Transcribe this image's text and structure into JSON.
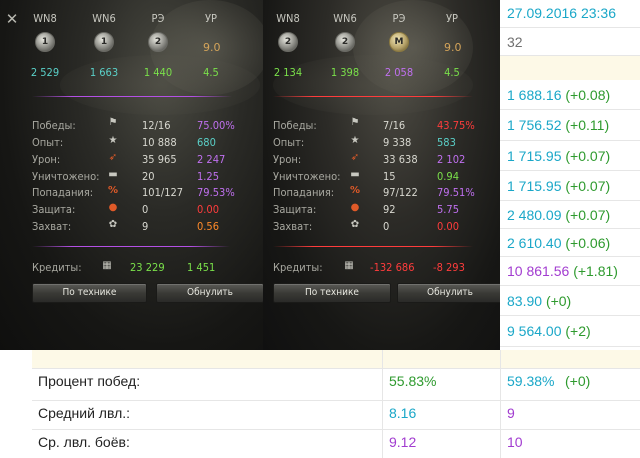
{
  "date_time": "27.09.2016 23:36",
  "battle_count": "32",
  "colors": {
    "green": "#2e9a2e",
    "teal": "#1aa7c8",
    "violet": "#a23cd0",
    "gray": "#707070",
    "game_cyan": "#5ad0c8",
    "game_green": "#7ae04a",
    "game_violet": "#c070f0",
    "game_red": "#ff3c3c",
    "game_yellow": "#e8d45a"
  },
  "game": {
    "close_icon": "close-icon",
    "buttons": {
      "by_vehicle": "По технике",
      "reset": "Обнулить"
    },
    "panels": [
      {
        "headers": [
          "WN8",
          "WN6",
          "РЭ",
          "УР"
        ],
        "medals": [
          "1",
          "1",
          "2"
        ],
        "level": "9.0",
        "ratings": [
          "2 529",
          "1 663",
          "1 440",
          "4.5"
        ],
        "rows": [
          {
            "label": "Победы:",
            "icon": "flag-icon",
            "value": "12/16",
            "extra": "75.00%"
          },
          {
            "label": "Опыт:",
            "icon": "star-icon",
            "value": "10 888",
            "extra": "680"
          },
          {
            "label": "Урон:",
            "icon": "shell-icon",
            "value": "35 965",
            "extra": "2 247"
          },
          {
            "label": "Уничтожено:",
            "icon": "tank-icon",
            "value": "20",
            "extra": "1.25"
          },
          {
            "label": "Попадания:",
            "icon": "percent-icon",
            "value": "101/127",
            "extra": "79.53%"
          },
          {
            "label": "Защита:",
            "icon": "defense-icon",
            "value": "0",
            "extra": "0.00"
          },
          {
            "label": "Захват:",
            "icon": "capture-icon",
            "value": "9",
            "extra": "0.56"
          }
        ],
        "credits_label": "Кредиты:",
        "credits": "23 229",
        "credits_avg": "1 451"
      },
      {
        "headers": [
          "WN8",
          "WN6",
          "РЭ",
          "УР"
        ],
        "medals": [
          "2",
          "2",
          "M"
        ],
        "level": "9.0",
        "ratings": [
          "2 134",
          "1 398",
          "2 058",
          "4.5"
        ],
        "rows": [
          {
            "label": "Победы:",
            "icon": "flag-icon",
            "value": "7/16",
            "extra": "43.75%"
          },
          {
            "label": "Опыт:",
            "icon": "star-icon",
            "value": "9 338",
            "extra": "583"
          },
          {
            "label": "Урон:",
            "icon": "shell-icon",
            "value": "33 638",
            "extra": "2 102"
          },
          {
            "label": "Уничтожено:",
            "icon": "tank-icon",
            "value": "15",
            "extra": "0.94"
          },
          {
            "label": "Попадания:",
            "icon": "percent-icon",
            "value": "97/122",
            "extra": "79.51%"
          },
          {
            "label": "Защита:",
            "icon": "defense-icon",
            "value": "92",
            "extra": "5.75"
          },
          {
            "label": "Захват:",
            "icon": "capture-icon",
            "value": "0",
            "extra": "0.00"
          }
        ],
        "credits_label": "Кредиты:",
        "credits": "-132 686",
        "credits_avg": "-8 293"
      }
    ]
  },
  "side_ratings": [
    {
      "value": "1 688.16",
      "delta": "(+0.08)",
      "color": "teal"
    },
    {
      "value": "1 756.52",
      "delta": "(+0.11)",
      "color": "teal"
    },
    {
      "value": "1 715.95",
      "delta": "(+0.07)",
      "color": "teal"
    },
    {
      "value": "1 715.95",
      "delta": "(+0.07)",
      "color": "teal"
    },
    {
      "value": "2 480.09",
      "delta": "(+0.07)",
      "color": "teal"
    },
    {
      "value": "2 610.40",
      "delta": "(+0.06)",
      "color": "teal"
    },
    {
      "value": "10 861.56",
      "delta": "(+1.81)",
      "color": "violet"
    },
    {
      "value": "83.90",
      "delta": "(+0)",
      "color": "teal"
    },
    {
      "value": "9 564.00",
      "delta": "(+2)",
      "color": "teal"
    }
  ],
  "bottom": [
    {
      "label": "Процент побед:",
      "v1": "55.83%",
      "v1_color": "green",
      "v2": "59.38%",
      "v2_delta": "(+0)"
    },
    {
      "label": "Средний лвл.:",
      "v1": "8.16",
      "v1_color": "teal",
      "v2": "9",
      "v2_delta": ""
    },
    {
      "label": "Ср. лвл. боёв:",
      "v1": "9.12",
      "v1_color": "violet",
      "v2": "10",
      "v2_delta": ""
    }
  ]
}
